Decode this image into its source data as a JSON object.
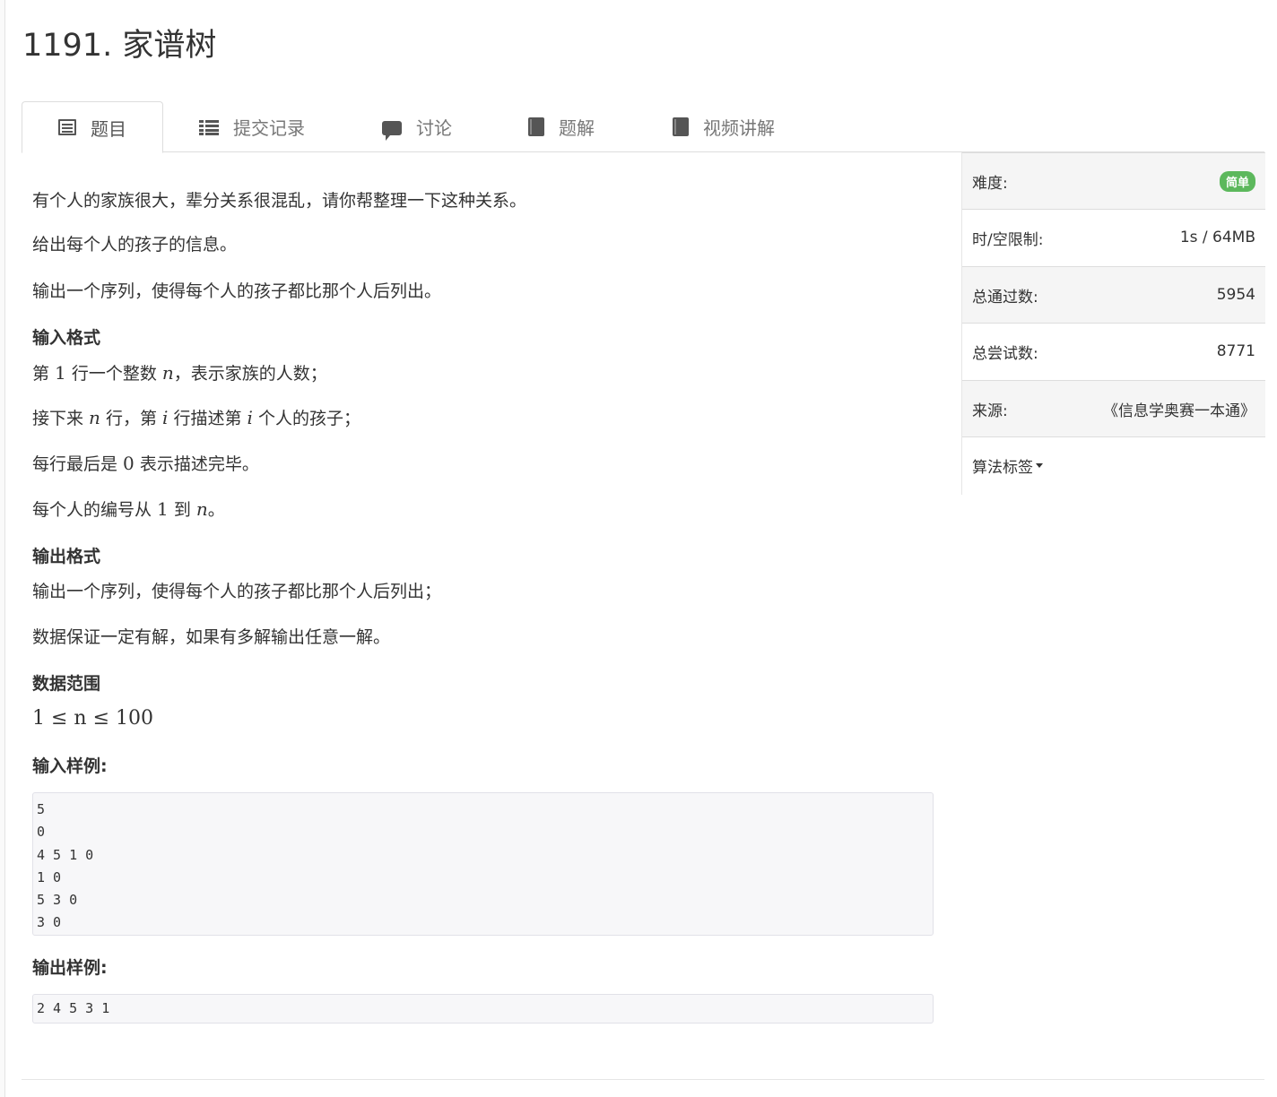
{
  "title": "1191. 家谱树",
  "tabs": [
    {
      "label": "题目",
      "icon": "list-alt-icon",
      "active": true
    },
    {
      "label": "提交记录",
      "icon": "th-list-icon",
      "active": false
    },
    {
      "label": "讨论",
      "icon": "comment-icon",
      "active": false
    },
    {
      "label": "题解",
      "icon": "book-icon",
      "active": false
    },
    {
      "label": "视频讲解",
      "icon": "book-icon",
      "active": false
    }
  ],
  "description": {
    "p1": "有个人的家族很大，辈分关系很混乱，请你帮整理一下这种关系。",
    "p2": "给出每个人的孩子的信息。",
    "p3": "输出一个序列，使得每个人的孩子都比那个人后列出。"
  },
  "input_format": {
    "heading": "输入格式",
    "l1_a": "第 ",
    "l1_one": "1",
    "l1_b": " 行一个整数 ",
    "l1_n": "n",
    "l1_c": "，表示家族的人数；",
    "l2_a": "接下来 ",
    "l2_n": "n",
    "l2_b": " 行，第 ",
    "l2_i": "i",
    "l2_c": " 行描述第 ",
    "l2_i2": "i",
    "l2_d": " 个人的孩子；",
    "l3_a": "每行最后是 ",
    "l3_zero": "0",
    "l3_b": " 表示描述完毕。",
    "l4_a": "每个人的编号从 ",
    "l4_one": "1",
    "l4_b": " 到 ",
    "l4_n": "n",
    "l4_c": "。"
  },
  "output_format": {
    "heading": "输出格式",
    "l1": "输出一个序列，使得每个人的孩子都比那个人后列出；",
    "l2": "数据保证一定有解，如果有多解输出任意一解。"
  },
  "range": {
    "heading": "数据范围",
    "expr": "1 ≤ n ≤ 100"
  },
  "sample_input": {
    "heading": "输入样例:",
    "lines": [
      "5",
      "0",
      "4 5 1 0",
      "1 0",
      "5 3 0",
      "3 0"
    ]
  },
  "sample_output": {
    "heading": "输出样例:",
    "lines": [
      "2 4 5 3 1"
    ]
  },
  "sidebar": {
    "difficulty_label": "难度:",
    "difficulty_value": "简单",
    "difficulty_color": "#5cb85c",
    "limit_label": "时/空限制:",
    "limit_value": "1s / 64MB",
    "passed_label": "总通过数:",
    "passed_value": "5954",
    "attempts_label": "总尝试数:",
    "attempts_value": "8771",
    "source_label": "来源:",
    "source_value": "《信息学奥赛一本通》",
    "tags_label": "算法标签"
  }
}
